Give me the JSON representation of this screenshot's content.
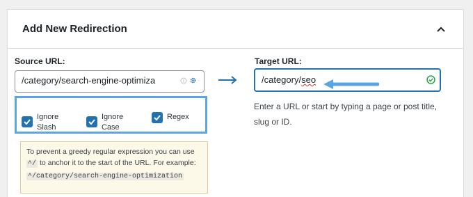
{
  "panel": {
    "title": "Add New Redirection",
    "collapse_icon": "chevron-up-icon"
  },
  "source": {
    "label": "Source URL:",
    "value": "/category/search-engine-optimiza",
    "icons": [
      "info-circle-icon",
      "gear-icon"
    ]
  },
  "target": {
    "label": "Target URL:",
    "value_prefix": "/category/",
    "value_word": "seo",
    "status_icon": "check-circle-icon",
    "help": "Enter a URL or start by typing a page or post title, slug or ID."
  },
  "options": [
    {
      "label": "Ignore Slash",
      "checked": true
    },
    {
      "label": "Ignore Case",
      "checked": true
    },
    {
      "label": "Regex",
      "checked": true
    }
  ],
  "notice": {
    "text1": "To prevent a greedy regular expression you can use",
    "code1": "^/",
    "text2": "to anchor it to the start of the URL. For example:",
    "code2": "^/category/search-engine-optimization"
  },
  "colors": {
    "accent": "#2271b1",
    "highlight": "#5ba4e5",
    "success": "#00a32a",
    "notice_bg": "#fcf9e8"
  }
}
